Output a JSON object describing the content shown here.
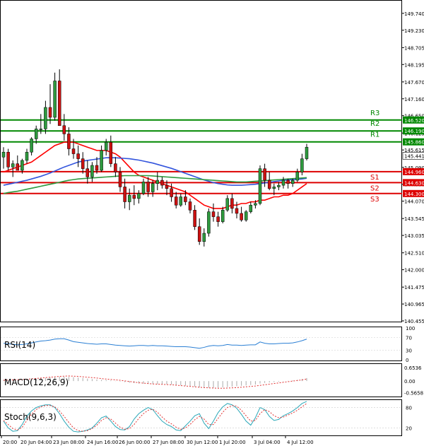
{
  "chart_data": {
    "type": "candlestick",
    "symbol_note": "",
    "price_axis": {
      "ylim": [
        140.455,
        150.1
      ],
      "ticks": [
        "149.740",
        "149.230",
        "148.705",
        "148.195",
        "147.670",
        "147.160",
        "146.650",
        "146.125",
        "145.615",
        "145.090",
        "144.580",
        "144.070",
        "143.545",
        "143.035",
        "142.510",
        "142.000",
        "141.475",
        "140.965",
        "140.455"
      ]
    },
    "x_labels": [
      "20:00",
      "20 Jun 04:00",
      "23 Jun 08:00",
      "24 Jun 16:00",
      "26 Jun 00:00",
      "27 Jun 08:00",
      "30 Jun 12:00",
      "1 Jul 20:00",
      "3 Jul 04:00",
      "4 Jul 12:00"
    ],
    "candles": [
      [
        145.4,
        145.7,
        145.05,
        145.55
      ],
      [
        145.55,
        145.65,
        145.0,
        145.1
      ],
      [
        145.1,
        145.3,
        144.8,
        145.2
      ],
      [
        145.2,
        145.45,
        145.0,
        145.0
      ],
      [
        145.0,
        145.35,
        144.9,
        145.3
      ],
      [
        145.3,
        145.65,
        145.2,
        145.55
      ],
      [
        145.55,
        146.0,
        145.45,
        145.95
      ],
      [
        145.95,
        146.35,
        145.8,
        146.25
      ],
      [
        146.25,
        146.7,
        146.1,
        146.25
      ],
      [
        146.25,
        147.1,
        146.1,
        146.9
      ],
      [
        146.9,
        147.6,
        146.4,
        146.6
      ],
      [
        146.6,
        147.95,
        146.5,
        147.7
      ],
      [
        147.7,
        148.05,
        146.8,
        146.35
      ],
      [
        146.35,
        146.7,
        145.9,
        146.1
      ],
      [
        146.1,
        146.3,
        145.45,
        145.65
      ],
      [
        145.65,
        145.95,
        145.35,
        145.5
      ],
      [
        145.5,
        145.75,
        145.1,
        145.35
      ],
      [
        145.35,
        145.55,
        144.9,
        145.05
      ],
      [
        145.05,
        145.3,
        144.6,
        144.8
      ],
      [
        144.8,
        145.25,
        144.65,
        145.15
      ],
      [
        145.15,
        145.4,
        144.9,
        145.0
      ],
      [
        145.0,
        145.75,
        144.95,
        145.6
      ],
      [
        145.6,
        145.95,
        145.45,
        145.85
      ],
      [
        145.85,
        146.05,
        145.1,
        145.2
      ],
      [
        145.2,
        145.4,
        144.8,
        144.95
      ],
      [
        144.95,
        145.1,
        144.35,
        144.5
      ],
      [
        144.5,
        144.75,
        143.85,
        144.05
      ],
      [
        144.05,
        144.45,
        143.8,
        144.25
      ],
      [
        144.25,
        144.55,
        143.95,
        144.15
      ],
      [
        144.15,
        144.4,
        144.0,
        144.3
      ],
      [
        144.3,
        144.75,
        144.25,
        144.65
      ],
      [
        144.65,
        144.8,
        144.2,
        144.35
      ],
      [
        144.35,
        144.7,
        144.2,
        144.6
      ],
      [
        144.6,
        144.95,
        144.4,
        144.7
      ],
      [
        144.7,
        144.8,
        144.45,
        144.55
      ],
      [
        144.55,
        144.7,
        144.25,
        144.45
      ],
      [
        144.45,
        144.6,
        144.05,
        144.2
      ],
      [
        144.2,
        144.35,
        143.85,
        143.95
      ],
      [
        143.95,
        144.3,
        143.9,
        144.2
      ],
      [
        144.2,
        144.4,
        143.95,
        144.05
      ],
      [
        144.05,
        144.15,
        143.7,
        143.8
      ],
      [
        143.8,
        143.95,
        143.2,
        143.3
      ],
      [
        143.3,
        143.55,
        142.75,
        142.85
      ],
      [
        142.85,
        143.25,
        142.7,
        143.1
      ],
      [
        143.1,
        143.85,
        143.0,
        143.75
      ],
      [
        143.75,
        144.0,
        143.45,
        143.6
      ],
      [
        143.6,
        143.75,
        143.3,
        143.45
      ],
      [
        143.45,
        143.9,
        143.4,
        143.8
      ],
      [
        143.8,
        144.25,
        143.75,
        144.15
      ],
      [
        144.15,
        144.3,
        143.7,
        143.85
      ],
      [
        143.85,
        144.05,
        143.55,
        143.7
      ],
      [
        143.7,
        143.9,
        143.45,
        143.5
      ],
      [
        143.5,
        143.8,
        143.45,
        143.75
      ],
      [
        143.75,
        144.05,
        143.7,
        143.95
      ],
      [
        143.95,
        144.1,
        143.85,
        144.0
      ],
      [
        144.0,
        145.15,
        143.95,
        145.05
      ],
      [
        145.05,
        145.2,
        144.5,
        144.7
      ],
      [
        144.7,
        144.95,
        144.4,
        144.45
      ],
      [
        144.45,
        144.6,
        144.25,
        144.5
      ],
      [
        144.5,
        144.65,
        144.4,
        144.55
      ],
      [
        144.55,
        144.8,
        144.45,
        144.7
      ],
      [
        144.7,
        144.75,
        144.45,
        144.6
      ],
      [
        144.6,
        144.75,
        144.5,
        144.7
      ],
      [
        144.7,
        145.05,
        144.65,
        144.95
      ],
      [
        144.95,
        145.5,
        144.85,
        145.35
      ],
      [
        145.35,
        145.8,
        145.3,
        145.7
      ]
    ],
    "overlays": [
      {
        "name": "red-ma",
        "color": "#ff0000",
        "values": [
          144.95,
          145.0,
          145.05,
          145.1,
          145.15,
          145.2,
          145.25,
          145.35,
          145.45,
          145.55,
          145.65,
          145.75,
          145.8,
          145.85,
          145.85,
          145.85,
          145.8,
          145.75,
          145.7,
          145.65,
          145.6,
          145.6,
          145.6,
          145.55,
          145.5,
          145.4,
          145.25,
          145.1,
          144.95,
          144.85,
          144.8,
          144.75,
          144.7,
          144.65,
          144.6,
          144.55,
          144.5,
          144.45,
          144.4,
          144.35,
          144.25,
          144.15,
          144.05,
          143.95,
          143.9,
          143.85,
          143.85,
          143.85,
          143.9,
          143.95,
          143.95,
          144.0,
          144.0,
          144.05,
          144.05,
          144.1,
          144.1,
          144.15,
          144.2,
          144.2,
          144.25,
          144.25,
          144.3,
          144.4,
          144.5,
          144.6
        ]
      },
      {
        "name": "blue-ma",
        "color": "#3355dd",
        "values": [
          144.55,
          144.58,
          144.61,
          144.64,
          144.67,
          144.7,
          144.74,
          144.78,
          144.82,
          144.87,
          144.92,
          144.98,
          145.04,
          145.1,
          145.15,
          145.2,
          145.25,
          145.28,
          145.3,
          145.32,
          145.34,
          145.36,
          145.38,
          145.38,
          145.38,
          145.37,
          145.36,
          145.35,
          145.33,
          145.31,
          145.28,
          145.25,
          145.22,
          145.18,
          145.14,
          145.1,
          145.06,
          145.01,
          144.96,
          144.91,
          144.86,
          144.81,
          144.76,
          144.71,
          144.67,
          144.63,
          144.6,
          144.58,
          144.56,
          144.55,
          144.55,
          144.55,
          144.56,
          144.57,
          144.58,
          144.6,
          144.62,
          144.64,
          144.66,
          144.68,
          144.7,
          144.71,
          144.72,
          144.73,
          144.74,
          144.76
        ]
      },
      {
        "name": "green-ma",
        "color": "#2e9a3e",
        "values": [
          144.3,
          144.33,
          144.35,
          144.37,
          144.4,
          144.43,
          144.46,
          144.49,
          144.52,
          144.55,
          144.58,
          144.61,
          144.64,
          144.67,
          144.7,
          144.72,
          144.74,
          144.75,
          144.76,
          144.77,
          144.78,
          144.79,
          144.8,
          144.81,
          144.82,
          144.83,
          144.84,
          144.84,
          144.84,
          144.84,
          144.84,
          144.84,
          144.83,
          144.82,
          144.81,
          144.8,
          144.79,
          144.78,
          144.77,
          144.76,
          144.75,
          144.74,
          144.73,
          144.72,
          144.71,
          144.7,
          144.69,
          144.68,
          144.67,
          144.66,
          144.65,
          144.65,
          144.65,
          144.66,
          144.67,
          144.68,
          144.69,
          144.7,
          144.71,
          144.72,
          144.73,
          144.74,
          144.75,
          144.76,
          144.77,
          144.78
        ]
      }
    ],
    "levels": [
      {
        "label": "R3",
        "value": 146.52,
        "tag": "146.520",
        "color": "#008800"
      },
      {
        "label": "R2",
        "value": 146.19,
        "tag": "146.190",
        "color": "#008800"
      },
      {
        "label": "R1",
        "value": 145.86,
        "tag": "145.860",
        "color": "#008800"
      },
      {
        "label": "S1",
        "value": 144.96,
        "tag": "144.960",
        "color": "#dd0000"
      },
      {
        "label": "S2",
        "value": 144.63,
        "tag": "144.630",
        "color": "#dd0000"
      },
      {
        "label": "S3",
        "value": 144.3,
        "tag": "144.300",
        "color": "#dd0000"
      }
    ],
    "current_price": {
      "tag": "145.441",
      "value": 145.441
    },
    "rsi": {
      "label": "RSI(14)",
      "ylim": [
        0,
        100
      ],
      "ticks": [
        "100",
        "70",
        "30",
        "0"
      ],
      "values": [
        52,
        50,
        49,
        47,
        48,
        50,
        53,
        56,
        59,
        60,
        62,
        65,
        66,
        66,
        62,
        57,
        55,
        53,
        51,
        50,
        49,
        50,
        50,
        48,
        46,
        45,
        44,
        43,
        44,
        45,
        45,
        44,
        45,
        44,
        44,
        43,
        42,
        41,
        41,
        41,
        40,
        38,
        36,
        39,
        43,
        45,
        44,
        45,
        48,
        46,
        46,
        45,
        46,
        47,
        47,
        56,
        52,
        50,
        50,
        51,
        52,
        52,
        53,
        56,
        60,
        65
      ]
    },
    "macd": {
      "label": "MACD(12,26,9)",
      "ticks": [
        "0.6536",
        "0.00",
        "-0.5658"
      ],
      "ylim": [
        -0.72,
        0.8
      ],
      "hist": [
        0.05,
        0.05,
        0.06,
        0.06,
        0.07,
        0.08,
        0.1,
        0.12,
        0.14,
        0.16,
        0.18,
        0.2,
        0.21,
        0.21,
        0.2,
        0.19,
        0.17,
        0.15,
        0.12,
        0.1,
        0.08,
        0.06,
        0.05,
        0.03,
        0.01,
        -0.02,
        -0.05,
        -0.08,
        -0.1,
        -0.12,
        -0.13,
        -0.14,
        -0.14,
        -0.15,
        -0.15,
        -0.16,
        -0.17,
        -0.19,
        -0.21,
        -0.23,
        -0.25,
        -0.28,
        -0.31,
        -0.32,
        -0.33,
        -0.33,
        -0.32,
        -0.31,
        -0.29,
        -0.27,
        -0.25,
        -0.23,
        -0.21,
        -0.19,
        -0.17,
        -0.12,
        -0.09,
        -0.07,
        -0.05,
        -0.03,
        -0.01,
        0.01,
        0.03,
        0.06,
        0.1,
        0.15
      ],
      "signal": [
        0.04,
        0.05,
        0.06,
        0.07,
        0.08,
        0.09,
        0.11,
        0.13,
        0.15,
        0.17,
        0.19,
        0.21,
        0.23,
        0.24,
        0.25,
        0.24,
        0.23,
        0.21,
        0.19,
        0.17,
        0.15,
        0.12,
        0.1,
        0.08,
        0.06,
        0.04,
        0.01,
        -0.02,
        -0.05,
        -0.08,
        -0.1,
        -0.12,
        -0.14,
        -0.15,
        -0.16,
        -0.17,
        -0.18,
        -0.2,
        -0.22,
        -0.24,
        -0.26,
        -0.28,
        -0.3,
        -0.32,
        -0.33,
        -0.34,
        -0.35,
        -0.35,
        -0.34,
        -0.33,
        -0.32,
        -0.3,
        -0.28,
        -0.26,
        -0.24,
        -0.21,
        -0.18,
        -0.15,
        -0.12,
        -0.09,
        -0.06,
        -0.03,
        0.0,
        0.03,
        0.06,
        0.1
      ]
    },
    "stoch": {
      "label": "Stoch(9,6,3)",
      "ylim": [
        0,
        100
      ],
      "ticks": [
        "80",
        "20"
      ],
      "k": [
        40,
        20,
        10,
        12,
        30,
        55,
        70,
        80,
        85,
        88,
        88,
        80,
        62,
        40,
        22,
        10,
        8,
        10,
        14,
        20,
        34,
        50,
        55,
        40,
        24,
        15,
        14,
        24,
        46,
        62,
        72,
        80,
        74,
        56,
        40,
        30,
        24,
        14,
        12,
        26,
        40,
        56,
        62,
        34,
        18,
        40,
        65,
        82,
        92,
        88,
        78,
        60,
        40,
        28,
        50,
        80,
        74,
        54,
        42,
        45,
        56,
        62,
        70,
        80,
        92,
        98
      ],
      "d": [
        42,
        30,
        18,
        14,
        22,
        42,
        60,
        74,
        82,
        86,
        86,
        82,
        70,
        54,
        36,
        20,
        12,
        10,
        12,
        18,
        28,
        42,
        50,
        46,
        34,
        22,
        16,
        18,
        30,
        48,
        62,
        72,
        75,
        66,
        52,
        40,
        32,
        22,
        16,
        20,
        30,
        44,
        54,
        46,
        30,
        30,
        48,
        66,
        80,
        86,
        84,
        72,
        56,
        40,
        42,
        62,
        74,
        68,
        56,
        50,
        52,
        58,
        64,
        72,
        82,
        92
      ]
    }
  }
}
